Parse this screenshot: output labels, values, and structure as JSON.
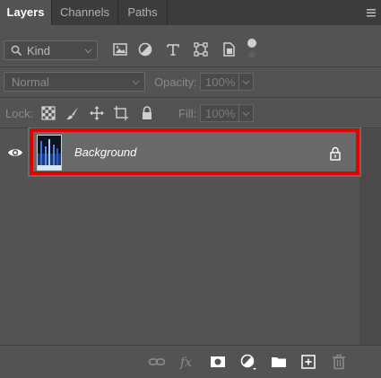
{
  "tabs": [
    {
      "label": "Layers",
      "active": true
    },
    {
      "label": "Channels",
      "active": false
    },
    {
      "label": "Paths",
      "active": false
    }
  ],
  "filter": {
    "kind_label": "Kind",
    "icons": [
      "image-filter-icon",
      "adjustment-filter-icon",
      "type-filter-icon",
      "shape-filter-icon",
      "smart-object-filter-icon",
      "filter-toggle-icon"
    ]
  },
  "blend": {
    "mode": "Normal",
    "opacity_label": "Opacity:",
    "opacity_value": "100%"
  },
  "lock": {
    "label": "Lock:",
    "fill_label": "Fill:",
    "fill_value": "100%",
    "icons": [
      "lock-transparent-pixels-icon",
      "lock-image-pixels-icon",
      "lock-position-icon",
      "lock-artboard-icon",
      "lock-all-icon"
    ]
  },
  "layers": [
    {
      "name": "Background",
      "visible": true,
      "locked": true,
      "selected": true
    }
  ],
  "bottom_icons": [
    "link-layers-icon",
    "layer-style-icon",
    "add-mask-icon",
    "adjustment-layer-icon",
    "new-group-icon",
    "new-layer-icon",
    "delete-layer-icon"
  ],
  "colors": {
    "panel_bg": "#535353",
    "tab_bar_bg": "#3c3c3c",
    "selected_row": "#696969",
    "highlight_box": "#e50000"
  }
}
